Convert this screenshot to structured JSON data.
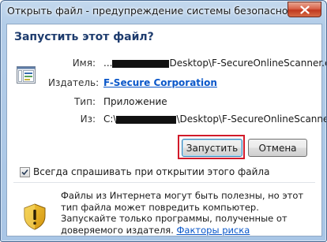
{
  "window": {
    "title": "Открыть файл - предупреждение системы безопасности"
  },
  "dialog": {
    "question": "Запустить этот файл?",
    "fields": {
      "name_label": "Имя:",
      "name_prefix": "...",
      "name_suffix": "Desktop\\F-SecureOnlineScanner.exe",
      "publisher_label": "Издатель:",
      "publisher_value": "F-Secure Corporation",
      "type_label": "Тип:",
      "type_value": "Приложение",
      "from_label": "Из:",
      "from_prefix": "C:\\",
      "from_suffix": "\\Desktop\\F-SecureOnlineScanner..."
    },
    "buttons": {
      "run": "Запустить",
      "cancel": "Отмена"
    },
    "checkbox": {
      "label": "Всегда спрашивать при открытии этого файла",
      "checked": true
    },
    "warning": {
      "text": "Файлы из Интернета могут быть полезны, но этот тип файла может повредить компьютер. Запускайте только программы, полученные от доверяемого издателя.",
      "link": "Факторы риска"
    }
  },
  "colors": {
    "heading": "#1e3c6e",
    "link": "#0a57c9",
    "highlight_box": "#d11a2a"
  },
  "icons": {
    "file": "application-file-icon",
    "warning": "security-shield-warning-icon",
    "close": "close-icon"
  }
}
